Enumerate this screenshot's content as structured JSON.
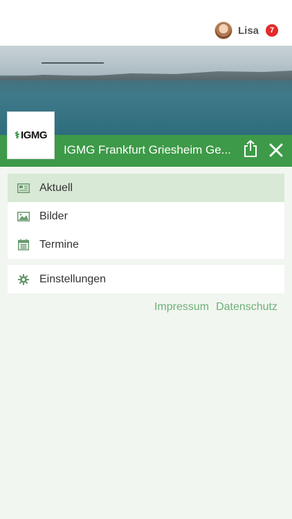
{
  "user": {
    "name": "Lisa",
    "notifications": "7"
  },
  "header": {
    "title": "IGMG Frankfurt Griesheim Ge...",
    "logo_text": "IGMG"
  },
  "menu": {
    "primary": [
      {
        "label": "Aktuell",
        "icon": "newspaper-icon",
        "active": true
      },
      {
        "label": "Bilder",
        "icon": "image-icon",
        "active": false
      },
      {
        "label": "Termine",
        "icon": "calendar-icon",
        "active": false
      }
    ],
    "secondary": [
      {
        "label": "Einstellungen",
        "icon": "gear-icon",
        "active": false
      }
    ]
  },
  "footer": {
    "impressum": "Impressum",
    "datenschutz": "Datenschutz"
  },
  "colors": {
    "accent": "#3d9a48",
    "active_bg": "#d8e9d6",
    "badge": "#e32b2b",
    "link": "#6fb07a"
  }
}
